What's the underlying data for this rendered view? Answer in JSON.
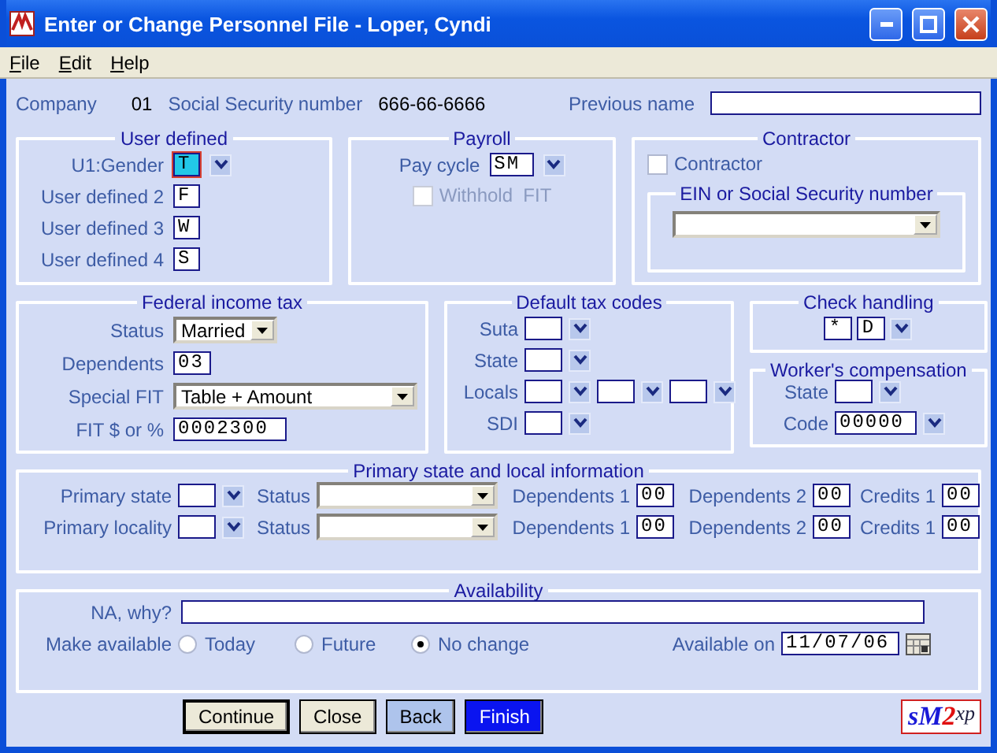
{
  "window": {
    "title": "Enter or Change Personnel File - Loper, Cyndi"
  },
  "menu": [
    {
      "label": "File"
    },
    {
      "label": "Edit"
    },
    {
      "label": "Help"
    }
  ],
  "header": {
    "company_label": "Company",
    "company": "01",
    "ssn_label": "Social Security number",
    "ssn": "666-66-6666",
    "previous_name_label": "Previous name"
  },
  "user_defined": {
    "title": "User defined",
    "fields": [
      {
        "label": "U1:Gender",
        "value": "T",
        "focused": true,
        "dropdown": true
      },
      {
        "label": "User defined 2",
        "value": "F",
        "focused": false,
        "dropdown": false
      },
      {
        "label": "User defined 3",
        "value": "W",
        "focused": false,
        "dropdown": false
      },
      {
        "label": "User defined 4",
        "value": "S",
        "focused": false,
        "dropdown": false
      }
    ]
  },
  "payroll": {
    "title": "Payroll",
    "pay_cycle_label": "Pay cycle",
    "pay_cycle": "SM",
    "withhold": {
      "label": "Withhold  FIT",
      "checked": false,
      "disabled": true
    }
  },
  "contractor": {
    "title": "Contractor",
    "checkbox": {
      "label": "Contractor",
      "checked": false,
      "disabled": false
    },
    "ein_title": "EIN or Social Security number"
  },
  "federal": {
    "title": "Federal income tax",
    "status_label": "Status",
    "status": "Married",
    "dependents_label": "Dependents",
    "dependents": "03",
    "special_fit_label": "Special FIT",
    "special_fit": "Table + Amount",
    "fit_label": "FIT $ or %",
    "fit": "0002300"
  },
  "tax_codes": {
    "title": "Default tax codes",
    "rows": [
      {
        "label": "Suta",
        "kind": "single"
      },
      {
        "label": "State",
        "kind": "single"
      },
      {
        "label": "Locals",
        "kind": "triple"
      },
      {
        "label": "SDI",
        "kind": "single"
      }
    ]
  },
  "check_handling": {
    "title": "Check handling",
    "values": [
      "*",
      "D"
    ]
  },
  "workers_comp": {
    "title": "Worker's compensation",
    "state_label": "State",
    "code_label": "Code",
    "code": "00000"
  },
  "primary": {
    "title": "Primary state and local information",
    "rows": [
      {
        "label": "Primary state",
        "status_label": "Status",
        "dep1_label": "Dependents 1",
        "dep1": "00",
        "dep2_label": "Dependents 2",
        "dep2": "00",
        "credits_label": "Credits 1",
        "credits": "00"
      },
      {
        "label": "Primary locality",
        "status_label": "Status",
        "dep1_label": "Dependents 1",
        "dep1": "00",
        "dep2_label": "Dependents 2",
        "dep2": "00",
        "credits_label": "Credits 1",
        "credits": "00"
      }
    ]
  },
  "availability": {
    "title": "Availability",
    "na_label": "NA, why?",
    "make_label": "Make available",
    "options": [
      {
        "label": "Today",
        "selected": false
      },
      {
        "label": "Future",
        "selected": false
      },
      {
        "label": "No change",
        "selected": true
      }
    ],
    "available_on_label": "Available on",
    "available_on": "11/07/06"
  },
  "buttons": [
    {
      "label": "Continue",
      "kind": "default"
    },
    {
      "label": "Close",
      "kind": "normal"
    },
    {
      "label": "Back",
      "kind": "light"
    },
    {
      "label": "Finish",
      "kind": "primary"
    }
  ],
  "logo": {
    "parts": [
      {
        "text": "s"
      },
      {
        "text": "M"
      },
      {
        "text": "2"
      },
      {
        "text": "xp"
      }
    ]
  }
}
